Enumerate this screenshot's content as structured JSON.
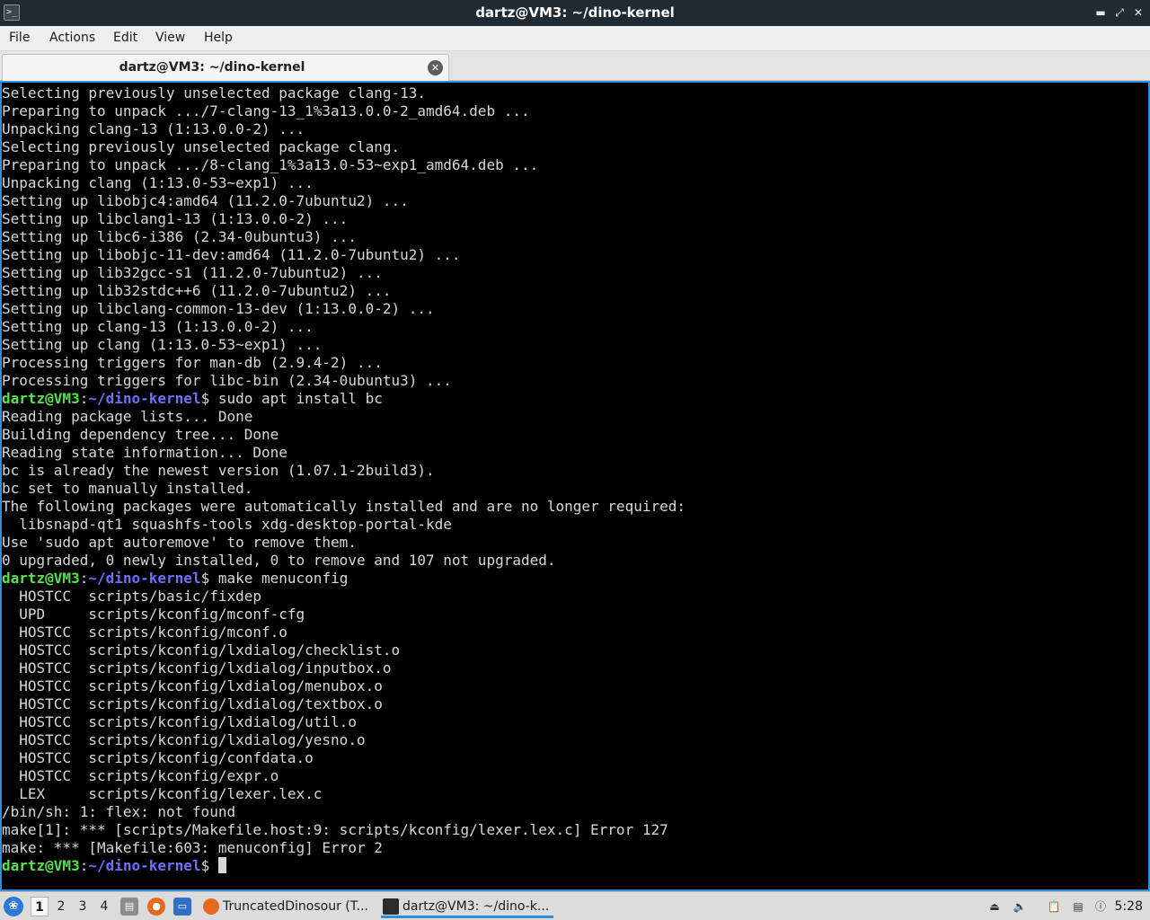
{
  "window": {
    "title": "dartz@VM3: ~/dino-kernel",
    "app_icon": "terminal-icon",
    "controls": [
      "minimize-icon",
      "maximize-icon",
      "close-icon"
    ]
  },
  "menubar": {
    "items": [
      "File",
      "Actions",
      "Edit",
      "View",
      "Help"
    ]
  },
  "tabs": [
    {
      "label": "dartz@VM3: ~/dino-kernel",
      "close_icon": "close-circle-icon"
    }
  ],
  "terminal": {
    "colors": {
      "background": "#000000",
      "text": "#d7d7d7",
      "prompt_user": "#57e04b",
      "prompt_path": "#6f6ff6"
    },
    "lines": [
      {
        "text": "Selecting previously unselected package clang-13."
      },
      {
        "text": "Preparing to unpack .../7-clang-13_1%3a13.0.0-2_amd64.deb ..."
      },
      {
        "text": "Unpacking clang-13 (1:13.0.0-2) ..."
      },
      {
        "text": "Selecting previously unselected package clang."
      },
      {
        "text": "Preparing to unpack .../8-clang_1%3a13.0-53~exp1_amd64.deb ..."
      },
      {
        "text": "Unpacking clang (1:13.0-53~exp1) ..."
      },
      {
        "text": "Setting up libobjc4:amd64 (11.2.0-7ubuntu2) ..."
      },
      {
        "text": "Setting up libclang1-13 (1:13.0.0-2) ..."
      },
      {
        "text": "Setting up libc6-i386 (2.34-0ubuntu3) ..."
      },
      {
        "text": "Setting up libobjc-11-dev:amd64 (11.2.0-7ubuntu2) ..."
      },
      {
        "text": "Setting up lib32gcc-s1 (11.2.0-7ubuntu2) ..."
      },
      {
        "text": "Setting up lib32stdc++6 (11.2.0-7ubuntu2) ..."
      },
      {
        "text": "Setting up libclang-common-13-dev (1:13.0.0-2) ..."
      },
      {
        "text": "Setting up clang-13 (1:13.0.0-2) ..."
      },
      {
        "text": "Setting up clang (1:13.0-53~exp1) ..."
      },
      {
        "text": "Processing triggers for man-db (2.9.4-2) ..."
      },
      {
        "text": "Processing triggers for libc-bin (2.34-0ubuntu3) ..."
      },
      {
        "prompt_user": "dartz@VM3",
        "prompt_path": "~/dino-kernel",
        "text": "$ sudo apt install bc"
      },
      {
        "text": "Reading package lists... Done"
      },
      {
        "text": "Building dependency tree... Done"
      },
      {
        "text": "Reading state information... Done"
      },
      {
        "text": "bc is already the newest version (1.07.1-2build3)."
      },
      {
        "text": "bc set to manually installed."
      },
      {
        "text": "The following packages were automatically installed and are no longer required:"
      },
      {
        "text": "  libsnapd-qt1 squashfs-tools xdg-desktop-portal-kde"
      },
      {
        "text": "Use 'sudo apt autoremove' to remove them."
      },
      {
        "text": "0 upgraded, 0 newly installed, 0 to remove and 107 not upgraded."
      },
      {
        "prompt_user": "dartz@VM3",
        "prompt_path": "~/dino-kernel",
        "text": "$ make menuconfig"
      },
      {
        "text": "  HOSTCC  scripts/basic/fixdep"
      },
      {
        "text": "  UPD     scripts/kconfig/mconf-cfg"
      },
      {
        "text": "  HOSTCC  scripts/kconfig/mconf.o"
      },
      {
        "text": "  HOSTCC  scripts/kconfig/lxdialog/checklist.o"
      },
      {
        "text": "  HOSTCC  scripts/kconfig/lxdialog/inputbox.o"
      },
      {
        "text": "  HOSTCC  scripts/kconfig/lxdialog/menubox.o"
      },
      {
        "text": "  HOSTCC  scripts/kconfig/lxdialog/textbox.o"
      },
      {
        "text": "  HOSTCC  scripts/kconfig/lxdialog/util.o"
      },
      {
        "text": "  HOSTCC  scripts/kconfig/lxdialog/yesno.o"
      },
      {
        "text": "  HOSTCC  scripts/kconfig/confdata.o"
      },
      {
        "text": "  HOSTCC  scripts/kconfig/expr.o"
      },
      {
        "text": "  LEX     scripts/kconfig/lexer.lex.c"
      },
      {
        "text": "/bin/sh: 1: flex: not found"
      },
      {
        "text": "make[1]: *** [scripts/Makefile.host:9: scripts/kconfig/lexer.lex.c] Error 127"
      },
      {
        "text": "make: *** [Makefile:603: menuconfig] Error 2"
      },
      {
        "prompt_user": "dartz@VM3",
        "prompt_path": "~/dino-kernel",
        "text": "$ ",
        "cursor": true
      }
    ]
  },
  "taskbar": {
    "start_icon": "lubuntu-menu-icon",
    "workspaces": [
      "1",
      "2",
      "3",
      "4"
    ],
    "active_workspace": "1",
    "quicklaunch": [
      "file-manager-icon",
      "firefox-icon",
      "desktop-icon"
    ],
    "tasks": [
      {
        "label": "TruncatedDinosour (T...",
        "icon": "firefox-icon",
        "active": false
      },
      {
        "label": "dartz@VM3: ~/dino-k...",
        "icon": "terminal-icon",
        "active": true
      }
    ],
    "tray": [
      "removable-drive-icon",
      "volume-icon",
      "clipboard-icon",
      "network-icon",
      "update-notifier-icon"
    ],
    "clock": "5:28"
  }
}
